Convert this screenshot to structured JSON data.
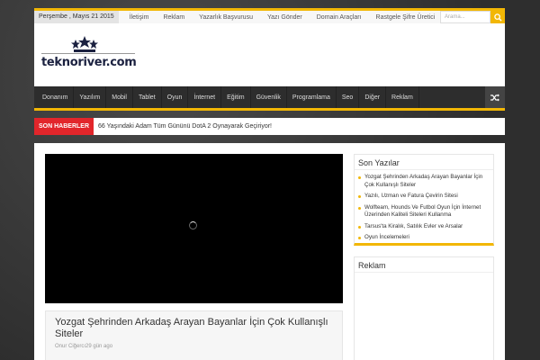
{
  "topbar": {
    "date": "Perşembe , Mayıs 21 2015",
    "links": [
      "İletişim",
      "Reklam",
      "Yazarlık Başvurusu",
      "Yazı Gönder",
      "Domain Araçları",
      "Rastgele Şifre Üretici"
    ],
    "search_placeholder": "Arama..."
  },
  "logo": {
    "text": "teknoriver.com"
  },
  "nav": [
    "Donanım",
    "Yazılım",
    "Mobil",
    "Tablet",
    "Oyun",
    "İnternet",
    "Eğitim",
    "Güvenlik",
    "Programlama",
    "Seo",
    "Diğer",
    "Reklam"
  ],
  "breaking": {
    "label": "SON HABERLER",
    "headline": "66 Yaşındaki Adam Tüm Gününü DotA 2 Oynayarak Geçiriyor!"
  },
  "post": {
    "title": "Yozgat Şehrinden Arkadaş Arayan Bayanlar İçin Çok Kullanışlı Siteler",
    "meta": "Onur Ciğercı29 gün ago"
  },
  "sidebar": {
    "recent_title": "Son Yazılar",
    "recent": [
      "Yozgat Şehrinden Arkadaş Arayan Bayanlar İçin Çok Kullanışlı Siteler",
      "Yazılı, Uzman ve Fatura Çevirin Sitesi",
      "Wolfteam, Hounds Ve Futbol Oyun İçin İnternet Üzerinden Kaliteli Siteleri Kullanma",
      "Tarsus'ta Kiralık, Satılık Evler ve Arsalar",
      "Oyun İncelemeleri"
    ],
    "ad_title": "Reklam"
  },
  "colors": {
    "accent": "#f2b705",
    "breaking": "#e2262b",
    "nav_bg": "#2d2d2d"
  }
}
